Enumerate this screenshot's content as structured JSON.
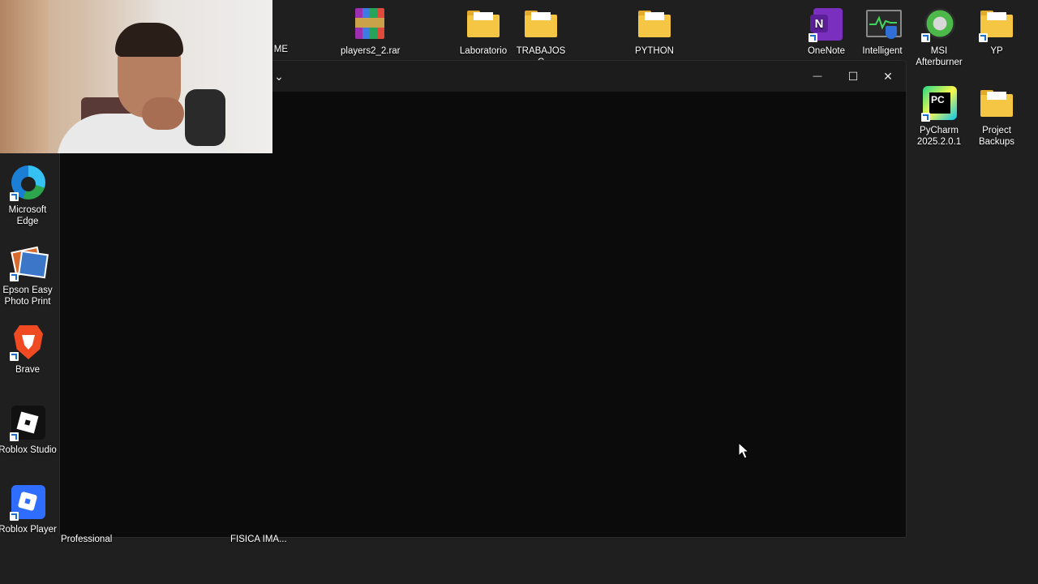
{
  "desktop": {
    "top_icons": [
      {
        "label": "ME"
      },
      {
        "label": "players2_2.rar"
      },
      {
        "label": "Laboratorio"
      },
      {
        "label": "TRABAJOS C"
      },
      {
        "label": "PYTHON"
      },
      {
        "label": "OneNote"
      },
      {
        "label": "Intelligent"
      },
      {
        "label": "MSI Afterburner"
      },
      {
        "label": "YP"
      }
    ],
    "right_icons": [
      {
        "label": "PyCharm 2025.2.0.1"
      },
      {
        "label": "Project Backups"
      }
    ],
    "left_icons": [
      {
        "label": "Microsoft Edge"
      },
      {
        "label": "Epson Easy Photo Print"
      },
      {
        "label": "Brave"
      },
      {
        "label": "Roblox Studio"
      },
      {
        "label": "Roblox Player"
      }
    ],
    "bottom_labels": [
      "Professional",
      "FISICA IMA..."
    ]
  },
  "window": {
    "chevron": "⌄",
    "minimize": "—",
    "maximize": "☐",
    "close": "✕"
  },
  "colors": {
    "desktop_bg": "#1f1f1f",
    "window_bg": "#0b0b0b",
    "titlebar_bg": "#1c1c1c",
    "folder": "#f5c644"
  }
}
